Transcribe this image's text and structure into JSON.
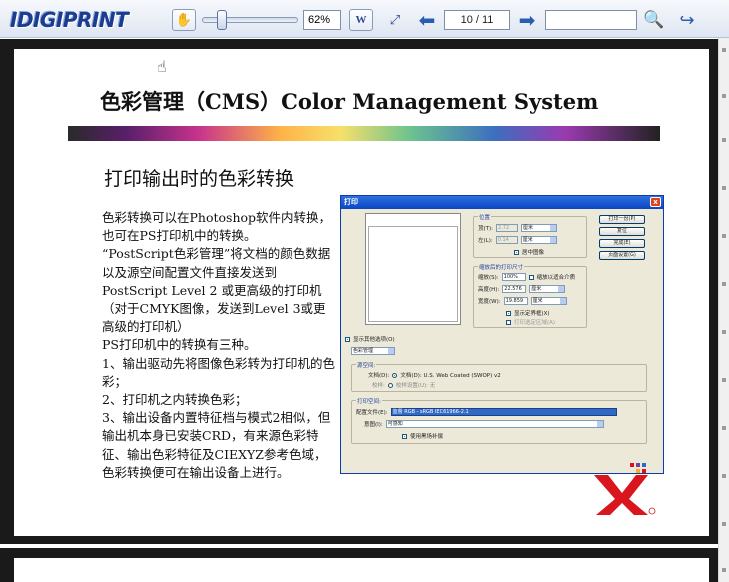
{
  "toolbar": {
    "logo": "IDIGIPRINT",
    "zoom": "62%",
    "page_indicator": "10 / 11",
    "search_value": "",
    "icons": [
      "hand-tool-icon",
      "word-doc-icon",
      "fit-page-icon",
      "prev-page-icon",
      "next-page-icon",
      "search-icon",
      "share-arrow-icon"
    ]
  },
  "slide": {
    "title": "色彩管理（CMS）Color Management System",
    "heading": "打印输出时的色彩转换",
    "body": [
      "色彩转换可以在Photoshop软件内转换，也可在PS打印机中的转换。",
      "“PostScript色彩管理”将文档的颜色数据以及源空间配置文件直接发送到 PostScript Level 2 或更高级的打印机（对于CMYK图像，发送到Level 3或更高级的打印机）",
      "PS打印机中的转换有三种。",
      "1、输出驱动先将图像色彩转为打印机的色彩；",
      "2、打印机之内转换色彩；",
      "3、输出设备内置特征档与模式2相似，但输出机本身已安装CRD，有来源色彩特征、输出色彩特征及CIEXYZ参考色域，色彩转换便可在输出设备上进行。"
    ]
  },
  "dialog": {
    "title": "打印",
    "close": "x",
    "position_group": "位置",
    "top_label": "顶(T):",
    "top_value": "2.72",
    "left_label": "左(L):",
    "left_value": "0.14",
    "unit": "厘米",
    "center_label": "居中图像",
    "scaled_group": "缩放后的打印尺寸",
    "scale_label": "缩放(S):",
    "scale_value": "100%",
    "fit_media": "缩放以适合介质",
    "height_label": "高度(H):",
    "height_value": "22.576",
    "width_label": "宽度(W):",
    "width_value": "19.859",
    "bbox_label": "显示定界框(X)",
    "print_selected": "打印选定区域(A)",
    "show_more": "显示其他选项(O)",
    "color_mgmt": "色彩管理",
    "source_group": "源空间:",
    "doc_label": "文档(D):",
    "doc_profile": "文档(D): U.S. Web Coated (SWOP) v2",
    "proof_label": "校样:",
    "proof_value": "校样设置(U): 无",
    "print_group": "打印空间:",
    "profile_label": "配置文件(E):",
    "profile_value": "监督 RGB - sRGB IEC61966-2.1",
    "intent_label": "意图(I):",
    "intent_value": "可感知",
    "bpc_label": "使用黑场补偿",
    "buttons": [
      "打印一份(P)",
      "复位",
      "完成(E)",
      "页面设置(G)"
    ]
  }
}
